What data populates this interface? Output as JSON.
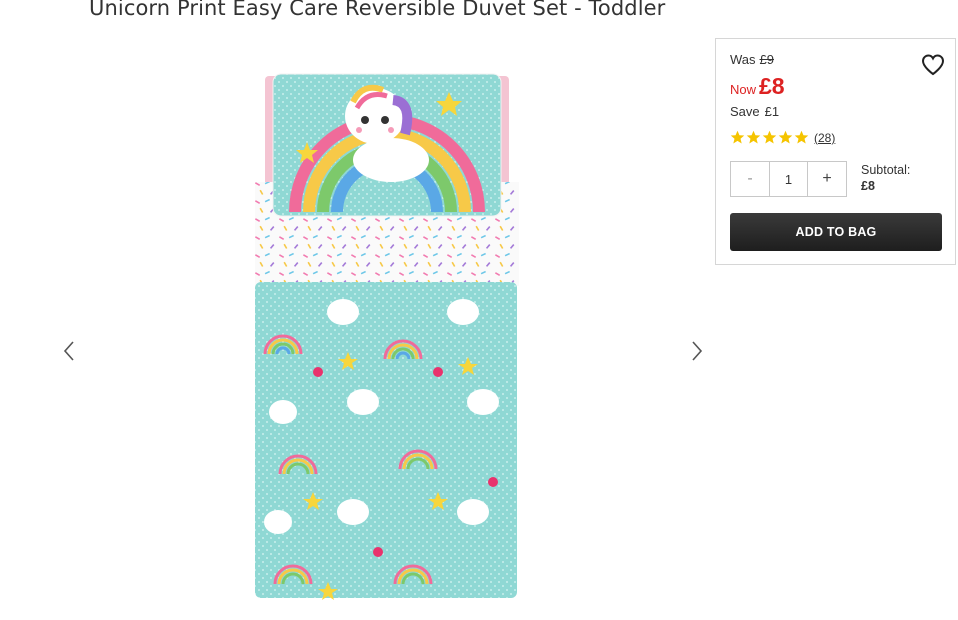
{
  "product": {
    "title": "Unicorn Print Easy Care Reversible Duvet Set - Toddler"
  },
  "carousel": {
    "prev_icon": "chevron-left-icon",
    "next_icon": "chevron-right-icon"
  },
  "pricing": {
    "was_label": "Was",
    "was_price": "£9",
    "now_label": "Now",
    "now_price": "£8",
    "save_label": "Save",
    "save_amount": "£1",
    "accent_color": "#d22222"
  },
  "rating": {
    "stars": 5,
    "review_count": "(28)",
    "star_color": "#f5c400"
  },
  "quantity": {
    "minus_label": "-",
    "value": "1",
    "plus_label": "+"
  },
  "subtotal": {
    "label": "Subtotal:",
    "value": "£8"
  },
  "actions": {
    "add_to_bag": "ADD TO BAG",
    "wishlist_icon": "heart-icon"
  }
}
